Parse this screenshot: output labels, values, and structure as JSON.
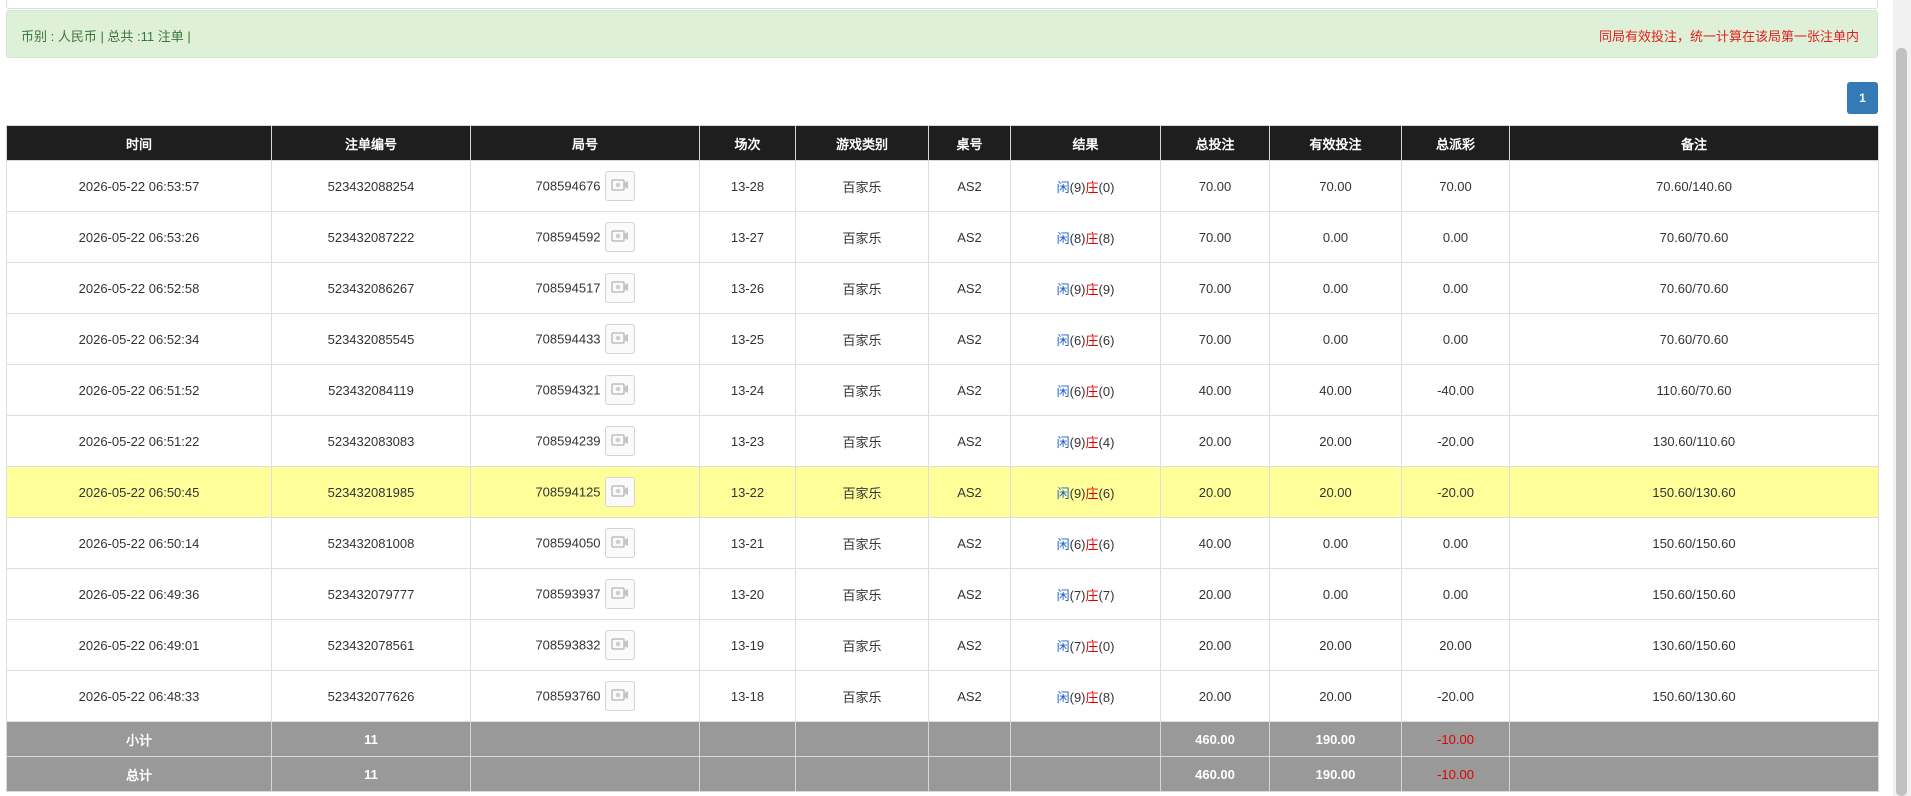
{
  "summary": {
    "currency_text": "币别 : 人民币 | 总共 :11 注单 |",
    "notice": "同局有效投注，统一计算在该局第一张注单内"
  },
  "pagination": {
    "current_page": "1"
  },
  "table": {
    "columns": [
      "时间",
      "注单编号",
      "局号",
      "场次",
      "游戏类别",
      "桌号",
      "结果",
      "总投注",
      "有效投注",
      "总派彩",
      "备注"
    ],
    "rows": [
      {
        "time": "2026-05-22 06:53:57",
        "bet_id": "523432088254",
        "round": "708594676",
        "session": "13-28",
        "game": "百家乐",
        "table": "AS2",
        "player_label": "闲",
        "player_score": "(9)",
        "banker_label": "庄",
        "banker_score": "(0)",
        "total_bet": "70.00",
        "valid_bet": "70.00",
        "payout": "70.00",
        "payout_negative": false,
        "note": "70.60/140.60",
        "highlight": false
      },
      {
        "time": "2026-05-22 06:53:26",
        "bet_id": "523432087222",
        "round": "708594592",
        "session": "13-27",
        "game": "百家乐",
        "table": "AS2",
        "player_label": "闲",
        "player_score": "(8)",
        "banker_label": "庄",
        "banker_score": "(8)",
        "total_bet": "70.00",
        "valid_bet": "0.00",
        "payout": "0.00",
        "payout_negative": false,
        "note": "70.60/70.60",
        "highlight": false
      },
      {
        "time": "2026-05-22 06:52:58",
        "bet_id": "523432086267",
        "round": "708594517",
        "session": "13-26",
        "game": "百家乐",
        "table": "AS2",
        "player_label": "闲",
        "player_score": "(9)",
        "banker_label": "庄",
        "banker_score": "(9)",
        "total_bet": "70.00",
        "valid_bet": "0.00",
        "payout": "0.00",
        "payout_negative": false,
        "note": "70.60/70.60",
        "highlight": false
      },
      {
        "time": "2026-05-22 06:52:34",
        "bet_id": "523432085545",
        "round": "708594433",
        "session": "13-25",
        "game": "百家乐",
        "table": "AS2",
        "player_label": "闲",
        "player_score": "(6)",
        "banker_label": "庄",
        "banker_score": "(6)",
        "total_bet": "70.00",
        "valid_bet": "0.00",
        "payout": "0.00",
        "payout_negative": false,
        "note": "70.60/70.60",
        "highlight": false
      },
      {
        "time": "2026-05-22 06:51:52",
        "bet_id": "523432084119",
        "round": "708594321",
        "session": "13-24",
        "game": "百家乐",
        "table": "AS2",
        "player_label": "闲",
        "player_score": "(6)",
        "banker_label": "庄",
        "banker_score": "(0)",
        "total_bet": "40.00",
        "valid_bet": "40.00",
        "payout": "-40.00",
        "payout_negative": true,
        "note": "110.60/70.60",
        "highlight": false
      },
      {
        "time": "2026-05-22 06:51:22",
        "bet_id": "523432083083",
        "round": "708594239",
        "session": "13-23",
        "game": "百家乐",
        "table": "AS2",
        "player_label": "闲",
        "player_score": "(9)",
        "banker_label": "庄",
        "banker_score": "(4)",
        "total_bet": "20.00",
        "valid_bet": "20.00",
        "payout": "-20.00",
        "payout_negative": true,
        "note": "130.60/110.60",
        "highlight": false
      },
      {
        "time": "2026-05-22 06:50:45",
        "bet_id": "523432081985",
        "round": "708594125",
        "session": "13-22",
        "game": "百家乐",
        "table": "AS2",
        "player_label": "闲",
        "player_score": "(9)",
        "banker_label": "庄",
        "banker_score": "(6)",
        "total_bet": "20.00",
        "valid_bet": "20.00",
        "payout": "-20.00",
        "payout_negative": true,
        "note": "150.60/130.60",
        "highlight": true
      },
      {
        "time": "2026-05-22 06:50:14",
        "bet_id": "523432081008",
        "round": "708594050",
        "session": "13-21",
        "game": "百家乐",
        "table": "AS2",
        "player_label": "闲",
        "player_score": "(6)",
        "banker_label": "庄",
        "banker_score": "(6)",
        "total_bet": "40.00",
        "valid_bet": "0.00",
        "payout": "0.00",
        "payout_negative": false,
        "note": "150.60/150.60",
        "highlight": false
      },
      {
        "time": "2026-05-22 06:49:36",
        "bet_id": "523432079777",
        "round": "708593937",
        "session": "13-20",
        "game": "百家乐",
        "table": "AS2",
        "player_label": "闲",
        "player_score": "(7)",
        "banker_label": "庄",
        "banker_score": "(7)",
        "total_bet": "20.00",
        "valid_bet": "0.00",
        "payout": "0.00",
        "payout_negative": false,
        "note": "150.60/150.60",
        "highlight": false
      },
      {
        "time": "2026-05-22 06:49:01",
        "bet_id": "523432078561",
        "round": "708593832",
        "session": "13-19",
        "game": "百家乐",
        "table": "AS2",
        "player_label": "闲",
        "player_score": "(7)",
        "banker_label": "庄",
        "banker_score": "(0)",
        "total_bet": "20.00",
        "valid_bet": "20.00",
        "payout": "20.00",
        "payout_negative": false,
        "note": "130.60/150.60",
        "highlight": false
      },
      {
        "time": "2026-05-22 06:48:33",
        "bet_id": "523432077626",
        "round": "708593760",
        "session": "13-18",
        "game": "百家乐",
        "table": "AS2",
        "player_label": "闲",
        "player_score": "(9)",
        "banker_label": "庄",
        "banker_score": "(8)",
        "total_bet": "20.00",
        "valid_bet": "20.00",
        "payout": "-20.00",
        "payout_negative": true,
        "note": "150.60/130.60",
        "highlight": false
      }
    ],
    "subtotal": {
      "label": "小计",
      "count": "11",
      "total_bet": "460.00",
      "valid_bet": "190.00",
      "payout": "-10.00"
    },
    "grand_total": {
      "label": "总计",
      "count": "11",
      "total_bet": "460.00",
      "valid_bet": "190.00",
      "payout": "-10.00"
    }
  },
  "icons": {
    "round_replay": "replay-video-icon"
  }
}
